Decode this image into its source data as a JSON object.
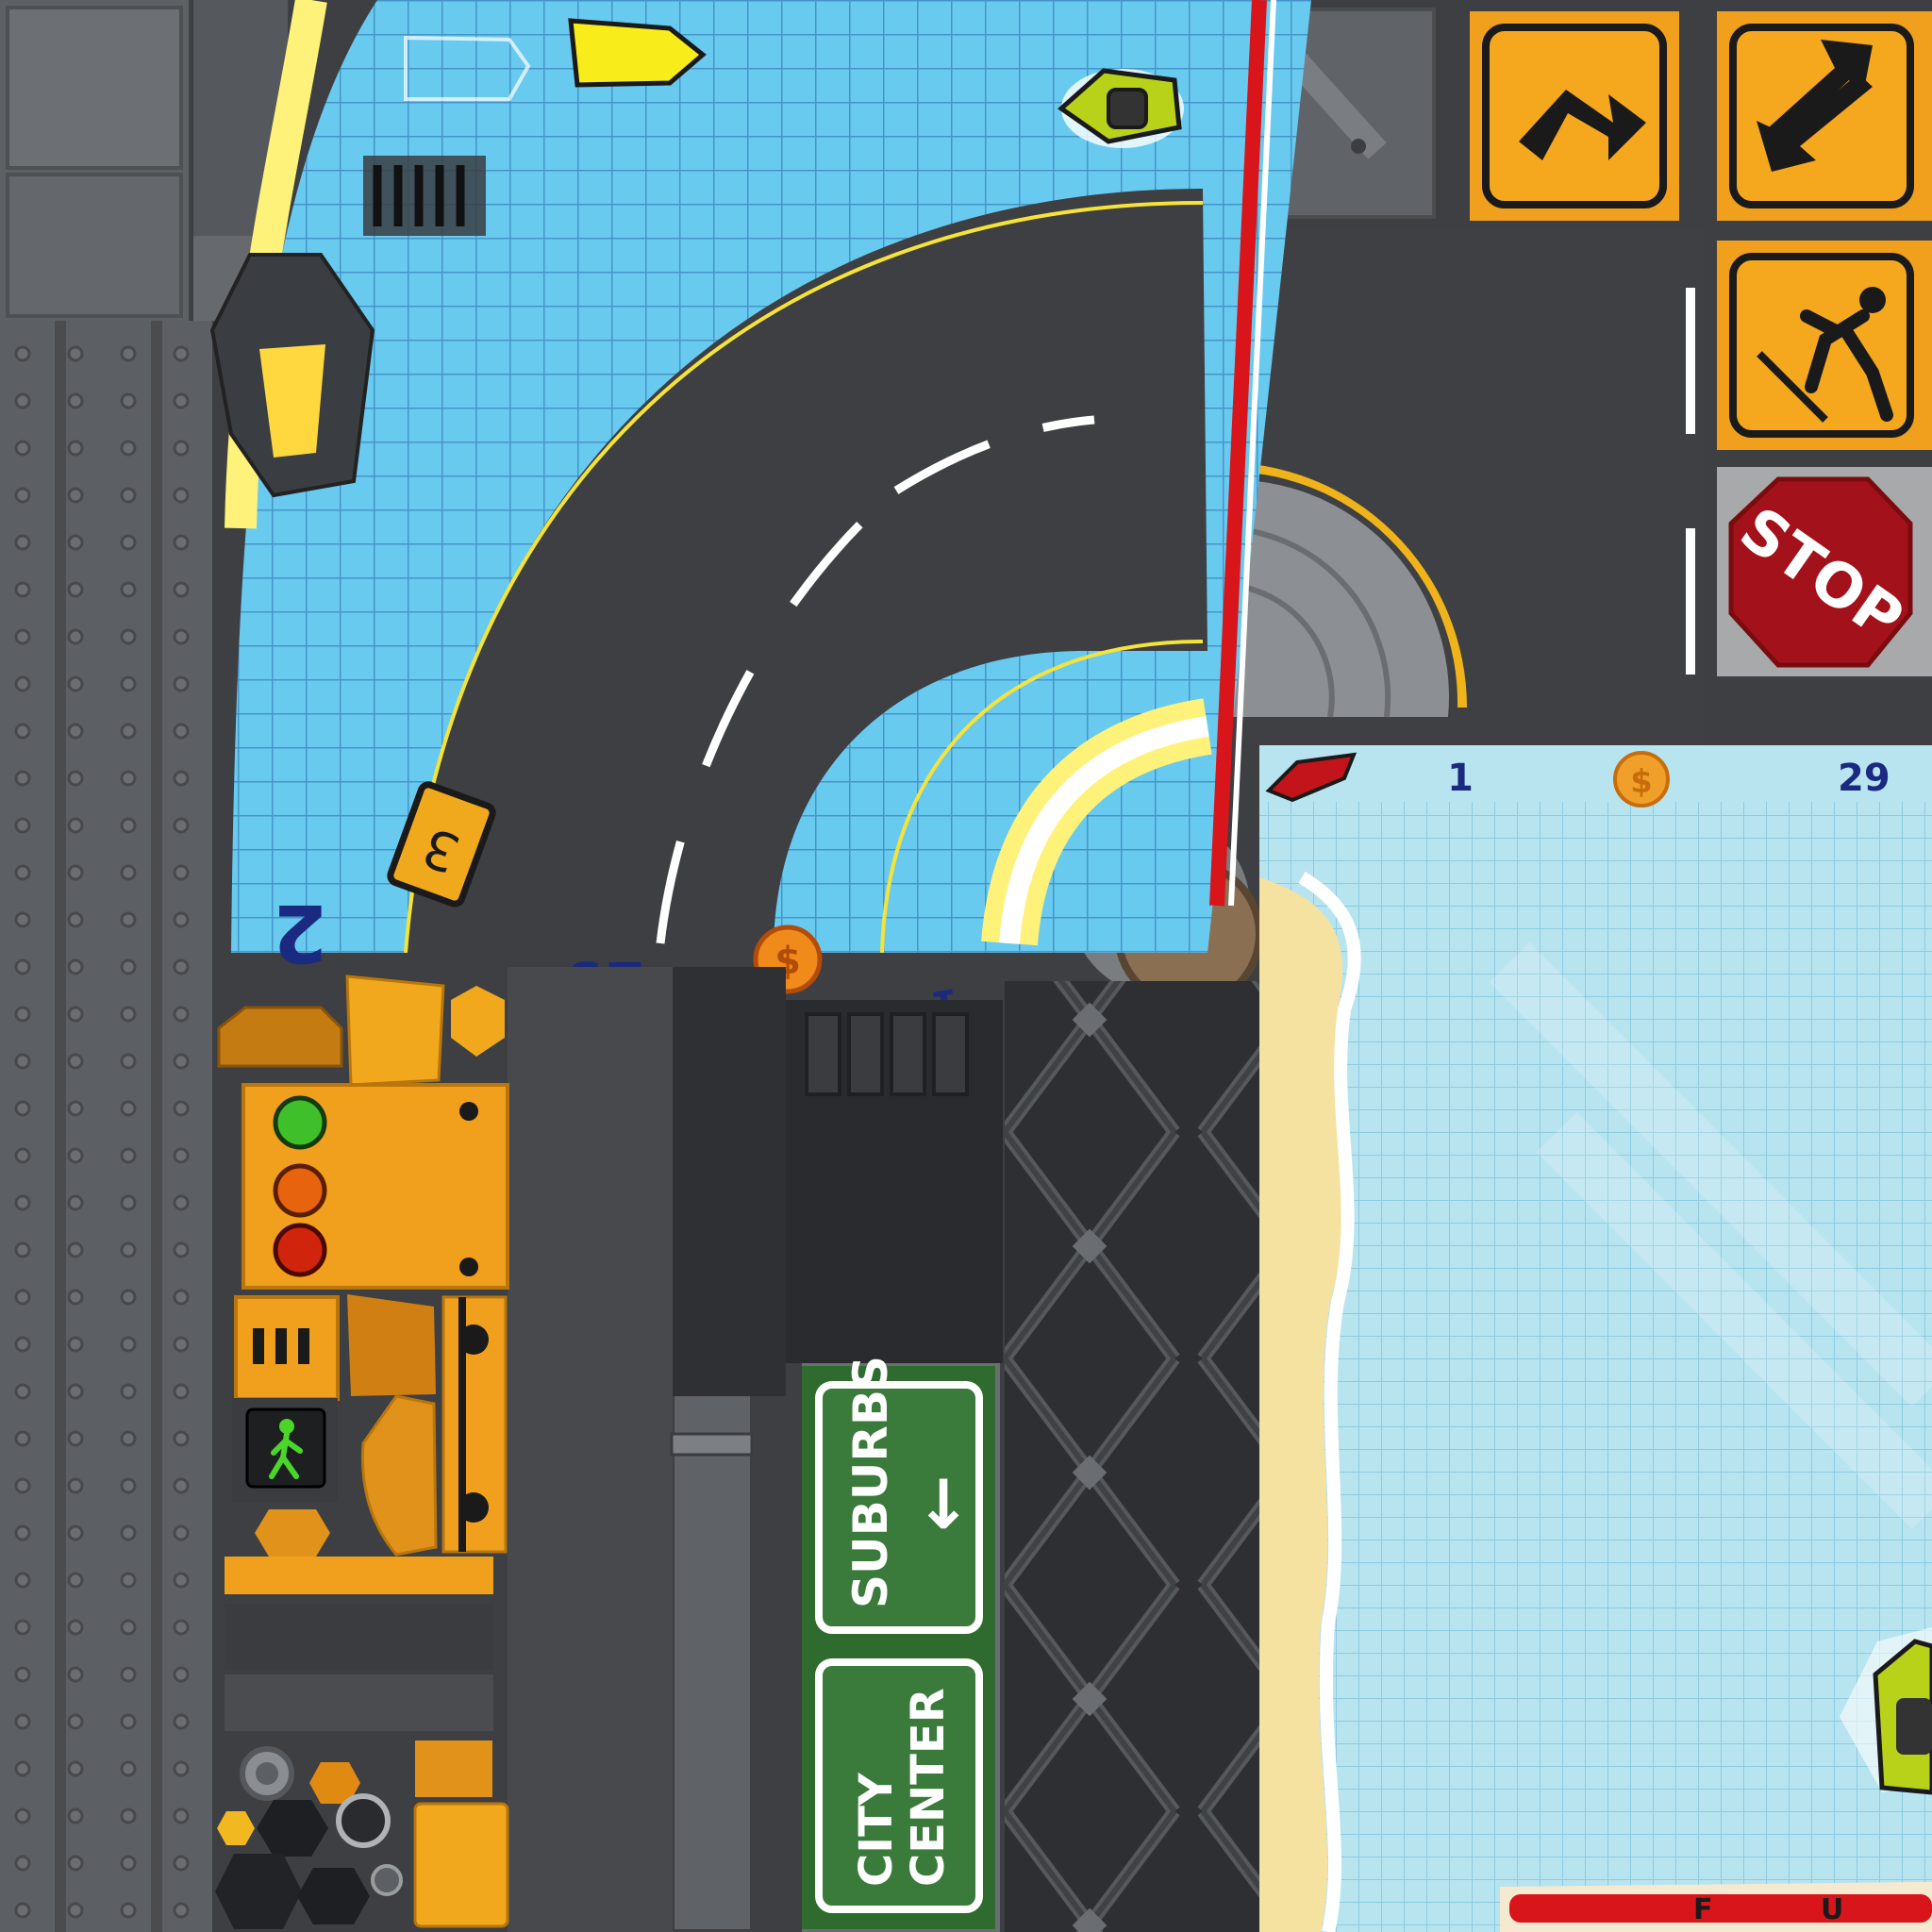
{
  "atlas": {
    "colors": {
      "water": "#5cc6f0",
      "water_dark": "#2a8fd0",
      "pool_light": "#b9e6f2",
      "amber": "#f2a81c",
      "sign_green": "#3a7a3a",
      "stop_red": "#a3121a",
      "asphalt": "#3f4144",
      "steel": "#5a5d61"
    }
  },
  "hud": {
    "top": {
      "lap": "1",
      "score": "29"
    },
    "curved_strip": {
      "lap": "1",
      "score": "29",
      "position": "2",
      "speed_sign": "3"
    }
  },
  "signs": {
    "suburbs": {
      "label": "SUBURBS",
      "arrow": "↓"
    },
    "city_center": {
      "line1": "CITY",
      "line2": "CENTER"
    },
    "stop": "STOP"
  },
  "fuel_bar": {
    "left": "F",
    "right": "U"
  },
  "icons": [
    "boat-icon",
    "coin-icon",
    "traffic-light-icon",
    "walk-signal-icon",
    "turn-arrow-sign-icon",
    "two-way-arrow-sign-icon",
    "pedestrian-sign-icon",
    "stop-sign-icon",
    "manhole-icon",
    "street-lamp-icon"
  ]
}
